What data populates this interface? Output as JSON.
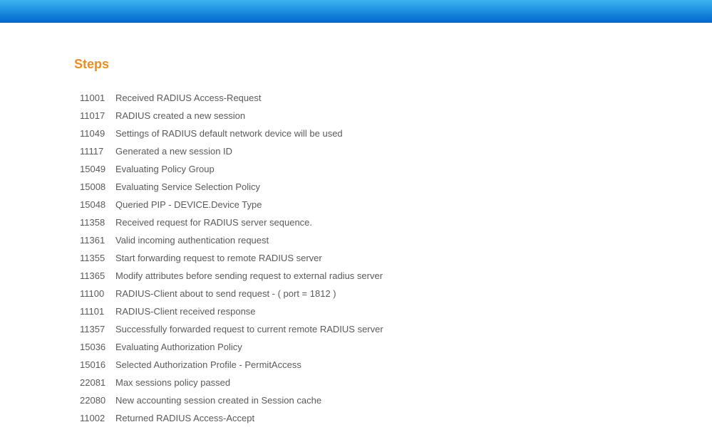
{
  "title": "Steps",
  "steps": [
    {
      "code": "11001",
      "desc": "Received RADIUS Access-Request"
    },
    {
      "code": "11017",
      "desc": "RADIUS created a new session"
    },
    {
      "code": "11049",
      "desc": "Settings of RADIUS default network device will be used"
    },
    {
      "code": "11117",
      "desc": "Generated a new session ID"
    },
    {
      "code": "15049",
      "desc": "Evaluating Policy Group"
    },
    {
      "code": "15008",
      "desc": "Evaluating Service Selection Policy"
    },
    {
      "code": "15048",
      "desc": "Queried PIP - DEVICE.Device Type"
    },
    {
      "code": "11358",
      "desc": "Received request for RADIUS server sequence."
    },
    {
      "code": "11361",
      "desc": "Valid incoming authentication request"
    },
    {
      "code": "11355",
      "desc": "Start forwarding request to remote RADIUS server"
    },
    {
      "code": "11365",
      "desc": "Modify attributes before sending request to external radius server"
    },
    {
      "code": "11100",
      "desc": "RADIUS-Client about to send request - ( port = 1812 )"
    },
    {
      "code": "11101",
      "desc": "RADIUS-Client received response"
    },
    {
      "code": "11357",
      "desc": "Successfully forwarded request to current remote RADIUS server"
    },
    {
      "code": "15036",
      "desc": "Evaluating Authorization Policy"
    },
    {
      "code": "15016",
      "desc": "Selected Authorization Profile - PermitAccess"
    },
    {
      "code": "22081",
      "desc": "Max sessions policy passed"
    },
    {
      "code": "22080",
      "desc": "New accounting session created in Session cache"
    },
    {
      "code": "11002",
      "desc": "Returned RADIUS Access-Accept"
    }
  ]
}
